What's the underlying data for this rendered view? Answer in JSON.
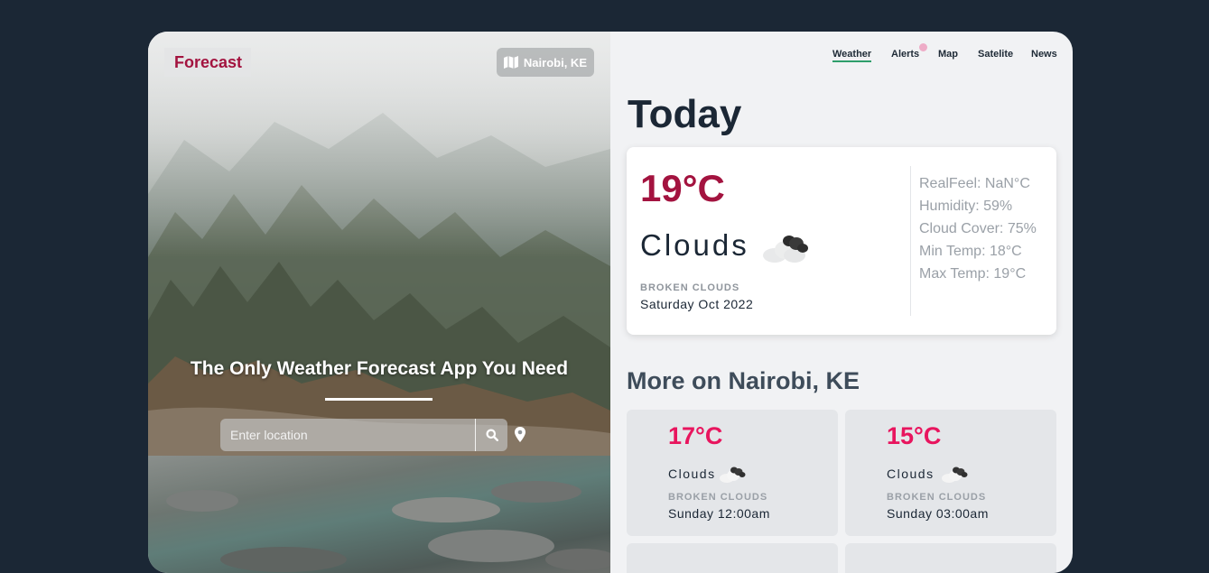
{
  "brand": "Forecast",
  "location_chip": {
    "label": "Nairobi, KE",
    "icon": "map-icon"
  },
  "hero": {
    "tagline": "The Only Weather Forecast App You Need",
    "search_placeholder": "Enter location",
    "search_icon": "search-icon",
    "pin_icon": "location-pin-icon"
  },
  "nav": {
    "tabs": [
      {
        "label": "Weather",
        "active": true
      },
      {
        "label": "Alerts",
        "active": false
      },
      {
        "label": "Map",
        "active": false
      },
      {
        "label": "Satelite",
        "active": false
      },
      {
        "label": "News",
        "active": false
      }
    ]
  },
  "today": {
    "title": "Today",
    "temp": "19°C",
    "condition": "Clouds",
    "icon": "cloud-icon",
    "description": "BROKEN CLOUDS",
    "date": "Saturday Oct 2022",
    "stats": {
      "realfeel": "RealFeel: NaN°C",
      "humidity": "Humidity: 59%",
      "cloud_cover": "Cloud Cover: 75%",
      "min_temp": "Min Temp: 18°C",
      "max_temp": "Max Temp: 19°C"
    }
  },
  "more": {
    "title": "More on Nairobi, KE",
    "cards": [
      {
        "temp": "17°C",
        "condition": "Clouds",
        "description": "BROKEN CLOUDS",
        "time": "Sunday 12:00am"
      },
      {
        "temp": "15°C",
        "condition": "Clouds",
        "description": "BROKEN CLOUDS",
        "time": "Sunday 03:00am"
      }
    ]
  },
  "colors": {
    "page_bg": "#1b2735",
    "brand_accent": "#a3133f",
    "forecast_temp": "#e8155e",
    "active_tab_underline": "#2f9e6b"
  }
}
